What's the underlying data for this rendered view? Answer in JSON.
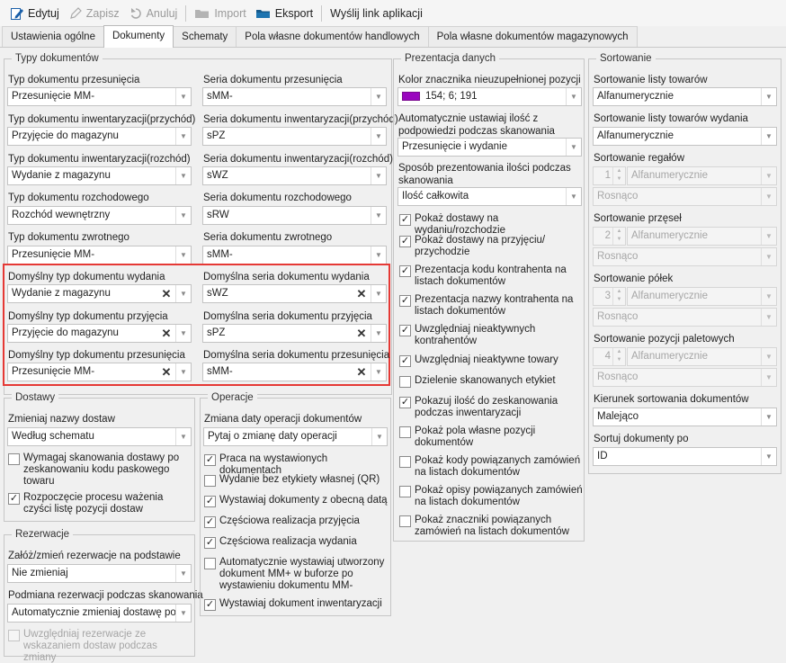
{
  "toolbar": {
    "edit": "Edytuj",
    "save": "Zapisz",
    "cancel": "Anuluj",
    "import": "Import",
    "export": "Eksport",
    "send_link": "Wyślij link aplikacji"
  },
  "tabs": [
    "Ustawienia ogólne",
    "Dokumenty",
    "Schematy",
    "Pola własne dokumentów handlowych",
    "Pola własne dokumentów magazynowych"
  ],
  "typy": {
    "title": "Typy dokumentów",
    "rows": [
      {
        "type_label": "Typ dokumentu przesunięcia",
        "type_value": "Przesunięcie MM-",
        "series_label": "Seria dokumentu przesunięcia",
        "series_value": "sMM-"
      },
      {
        "type_label": "Typ dokumentu inwentaryzacji(przychód)",
        "type_value": "Przyjęcie do magazynu",
        "series_label": "Seria dokumentu inwentaryzacji(przychód)",
        "series_value": "sPZ"
      },
      {
        "type_label": "Typ dokumentu inwentaryzacji(rozchód)",
        "type_value": "Wydanie z magazynu",
        "series_label": "Seria dokumentu inwentaryzacji(rozchód)",
        "series_value": "sWZ"
      },
      {
        "type_label": "Typ dokumentu rozchodowego",
        "type_value": "Rozchód wewnętrzny",
        "series_label": "Seria dokumentu rozchodowego",
        "series_value": "sRW"
      },
      {
        "type_label": "Typ dokumentu zwrotnego",
        "type_value": "Przesunięcie MM-",
        "series_label": "Seria dokumentu zwrotnego",
        "series_value": "sMM-"
      },
      {
        "type_label": "Domyślny typ dokumentu wydania",
        "type_value": "Wydanie z magazynu",
        "series_label": "Domyślna seria dokumentu wydania",
        "series_value": "sWZ"
      },
      {
        "type_label": "Domyślny typ dokumentu przyjęcia",
        "type_value": "Przyjęcie do magazynu",
        "series_label": "Domyślna seria dokumentu przyjęcia",
        "series_value": "sPZ"
      },
      {
        "type_label": "Domyślny typ dokumentu przesunięcia",
        "type_value": "Przesunięcie MM-",
        "series_label": "Domyślna seria dokumentu przesunięcia",
        "series_value": "sMM-"
      }
    ]
  },
  "dostawy": {
    "title": "Dostawy",
    "rename_label": "Zmieniaj nazwy dostaw",
    "rename_value": "Według schematu",
    "chk_scan": "Wymagaj skanowania dostawy po zeskanowaniu kodu paskowego towaru",
    "chk_weigh": "Rozpoczęcie procesu ważenia czyści listę pozycji dostaw"
  },
  "rezerwacje": {
    "title": "Rezerwacje",
    "create_label": "Załóż/zmień rezerwacje na podstawie",
    "create_value": "Nie zmieniaj",
    "swap_label": "Podmiana rezerwacji podczas skanowania",
    "swap_value": "Automatycznie zmieniaj dostawę po...",
    "chk_include": "Uwzględniaj rezerwacje ze wskazaniem dostaw podczas zmiany"
  },
  "operacje": {
    "title": "Operacje",
    "date_label": "Zmiana daty operacji dokumentów",
    "date_value": "Pytaj o zmianę daty operacji",
    "checks": [
      {
        "label": "Praca na wystawionych dokumentach",
        "checked": "✓"
      },
      {
        "label": "Wydanie bez etykiety własnej (QR)",
        "checked": ""
      },
      {
        "label": "Wystawiaj dokumenty z obecną datą",
        "checked": "✓"
      },
      {
        "label": "Częściowa realizacja przyjęcia",
        "checked": "✓"
      },
      {
        "label": "Częściowa realizacja wydania",
        "checked": "✓"
      },
      {
        "label": "Automatycznie wystawiaj utworzony dokument MM+ w buforze po wystawieniu dokumentu MM-",
        "checked": ""
      },
      {
        "label": "Wystawiaj dokument inwentaryzacji",
        "checked": "✓"
      }
    ]
  },
  "prezentacja": {
    "title": "Prezentacja danych",
    "color_label": "Kolor znacznika nieuzupełnionej pozycji",
    "color_value": "154; 6; 191",
    "color_hex": "#9a06bf",
    "auto_qty_label": "Automatycznie ustawiaj ilość z podpowiedzi podczas skanowania",
    "auto_qty_value": "Przesunięcie i wydanie",
    "present_label": "Sposób prezentowania ilości podczas skanowania",
    "present_value": "Ilość całkowita",
    "checks": [
      {
        "label": "Pokaż dostawy na wydaniu/rozchodzie",
        "checked": "✓"
      },
      {
        "label": "Pokaż dostawy na przyjęciu/ przychodzie",
        "checked": "✓"
      },
      {
        "label": "Prezentacja kodu kontrahenta na listach dokumentów",
        "checked": "✓"
      },
      {
        "label": "Prezentacja nazwy kontrahenta na listach dokumentów",
        "checked": "✓"
      },
      {
        "label": "Uwzględniaj nieaktywnych kontrahentów",
        "checked": "✓"
      },
      {
        "label": "Uwzględniaj nieaktywne towary",
        "checked": "✓"
      },
      {
        "label": "Dzielenie skanowanych etykiet",
        "checked": ""
      },
      {
        "label": "Pokazuj ilość do zeskanowania podczas inwentaryzacji",
        "checked": "✓"
      },
      {
        "label": "Pokaż pola własne pozycji dokumentów",
        "checked": ""
      },
      {
        "label": "Pokaż kody powiązanych zamówień na listach dokumentów",
        "checked": ""
      },
      {
        "label": "Pokaż opisy powiązanych zamówień na listach dokumentów",
        "checked": ""
      },
      {
        "label": "Pokaż znaczniki powiązanych zamówień na listach dokumentów",
        "checked": ""
      }
    ]
  },
  "sortowanie": {
    "title": "Sortowanie",
    "list_label": "Sortowanie listy towarów",
    "list_value": "Alfanumerycznie",
    "issue_label": "Sortowanie listy towarów wydania",
    "issue_value": "Alfanumerycznie",
    "groups": [
      {
        "label": "Sortowanie regałów",
        "num": "1",
        "mode": "Alfanumerycznie",
        "order": "Rosnąco"
      },
      {
        "label": "Sortowanie przęseł",
        "num": "2",
        "mode": "Alfanumerycznie",
        "order": "Rosnąco"
      },
      {
        "label": "Sortowanie półek",
        "num": "3",
        "mode": "Alfanumerycznie",
        "order": "Rosnąco"
      },
      {
        "label": "Sortowanie pozycji paletowych",
        "num": "4",
        "mode": "Alfanumerycznie",
        "order": "Rosnąco"
      }
    ],
    "dir_label": "Kierunek sortowania dokumentów",
    "dir_value": "Malejąco",
    "by_label": "Sortuj dokumenty po",
    "by_value": "ID"
  }
}
